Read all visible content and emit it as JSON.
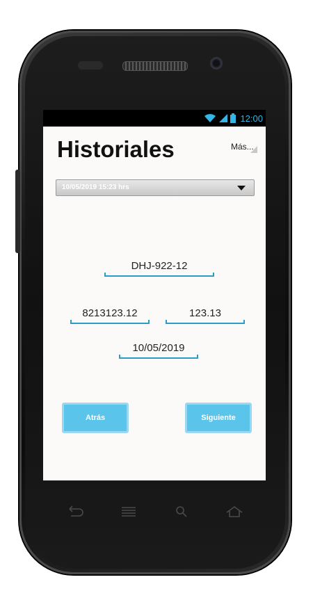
{
  "status_bar": {
    "time": "12:00"
  },
  "header": {
    "title": "Historiales",
    "more_label": "Más..."
  },
  "history_select": {
    "selected": "10/05/2019 15:23 hrs"
  },
  "fields": {
    "plate": "DHJ-922-12",
    "value_left": "8213123.12",
    "value_right": "123.13",
    "date": "10/05/2019"
  },
  "buttons": {
    "back": "Atrás",
    "next": "Siguiente"
  },
  "colors": {
    "accent": "#33b5e5",
    "button": "#5bc4ea",
    "underline": "#2a9cc8"
  },
  "nav_icons": [
    "back-icon",
    "recent-apps-icon",
    "search-icon",
    "home-icon"
  ]
}
